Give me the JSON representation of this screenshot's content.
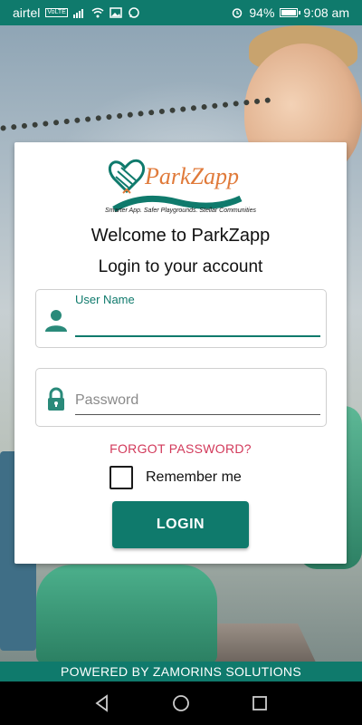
{
  "status_bar": {
    "carrier": "airtel",
    "volte": "VoLTE",
    "battery": "94%",
    "time": "9:08 am",
    "icons": [
      "signal-icon",
      "wifi-icon",
      "image-icon",
      "whatsapp-icon",
      "alarm-icon",
      "battery-icon"
    ]
  },
  "logo": {
    "brand": "ParkZapp",
    "tagline": "Smarter App. Safer Playgrounds. Stellar Communities"
  },
  "card": {
    "welcome": "Welcome to ParkZapp",
    "login_title": "Login to your account"
  },
  "form": {
    "username_label": "User Name",
    "username_value": "",
    "password_placeholder": "Password",
    "password_value": "",
    "forgot_password": "FORGOT PASSWORD?",
    "remember_me": "Remember me",
    "remember_checked": false,
    "login_button": "LOGIN"
  },
  "footer": {
    "text": "POWERED BY ZAMORINS SOLUTIONS"
  },
  "colors": {
    "primary": "#0f7a6c",
    "link": "#d2395a",
    "logo_orange": "#e07a3a"
  },
  "navbar": {
    "icons": [
      "back-icon",
      "home-icon",
      "recents-icon"
    ]
  }
}
